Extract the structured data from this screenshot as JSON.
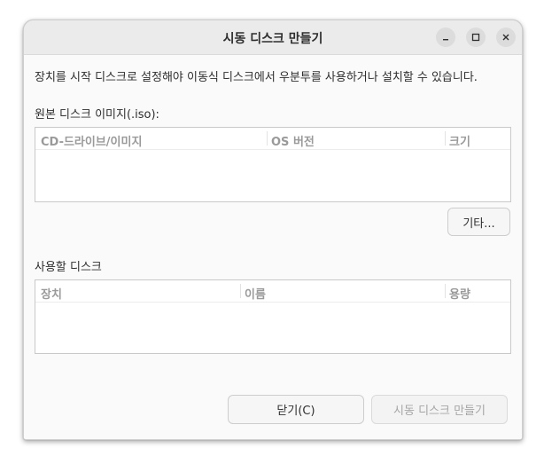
{
  "window": {
    "title": "시동 디스크 만들기",
    "minimize_icon": "minimize-icon",
    "maximize_icon": "maximize-icon",
    "close_icon": "close-icon"
  },
  "description": "장치를 시작 디스크로 설정해야 이동식 디스크에서 우분투를 사용하거나 설치할 수 있습니다.",
  "source": {
    "label": "원본 디스크 이미지(.iso):",
    "columns": [
      "CD-드라이브/이미지",
      "OS 버전",
      "크기"
    ],
    "rows": []
  },
  "other_button": "기타...",
  "target": {
    "label": "사용할 디스크",
    "columns": [
      "장치",
      "이름",
      "용량"
    ],
    "rows": []
  },
  "footer": {
    "close_button": "닫기(C)",
    "create_button": "시동 디스크 만들기"
  },
  "colors": {
    "titlebar": "#ebebeb",
    "window_bg": "#fafafa",
    "header_text": "#9a9a9a"
  }
}
